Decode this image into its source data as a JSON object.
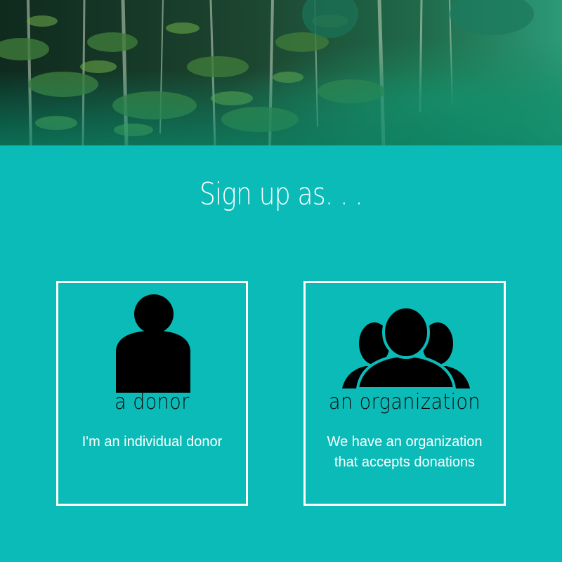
{
  "colors": {
    "background": "#0bbbb8",
    "card_border": "#ffffff",
    "icon": "#000000",
    "title_text": "#ffffff"
  },
  "hero": {
    "image": "rainforest-photo"
  },
  "page": {
    "title": "Sign up as. . ."
  },
  "cards": [
    {
      "icon": "person-icon",
      "title": "a donor",
      "description": "I'm an individual donor"
    },
    {
      "icon": "group-icon",
      "title": "an organization",
      "description_lines": [
        "We have an organization",
        "that accepts donations"
      ]
    }
  ]
}
